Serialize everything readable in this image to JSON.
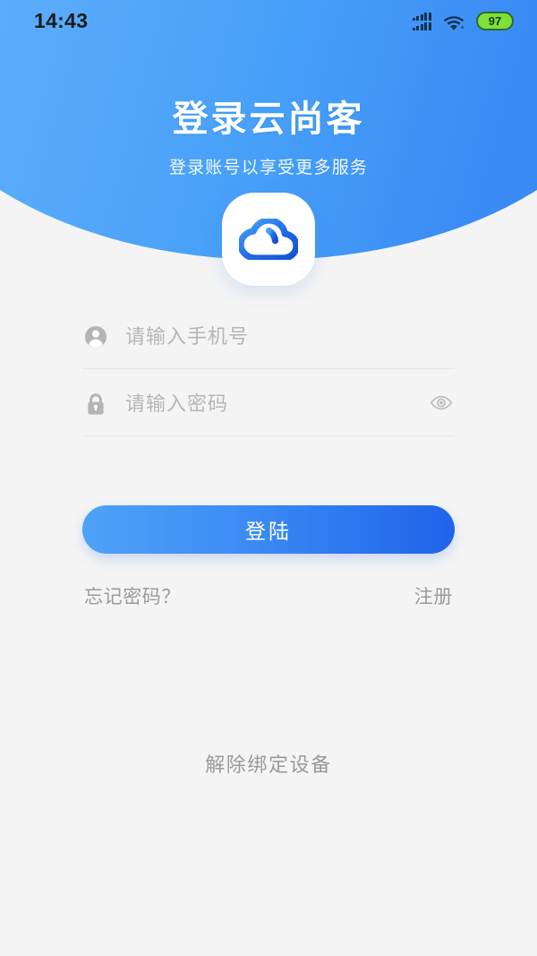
{
  "status_bar": {
    "time": "14:43",
    "signal_icon": "dual-signal-bars-icon",
    "wifi_icon": "wifi-icon",
    "battery_level": "97",
    "battery_icon": "battery-icon"
  },
  "header": {
    "title": "登录云尚客",
    "subtitle": "登录账号以享受更多服务",
    "logo_icon": "cloud-logo-icon"
  },
  "form": {
    "phone": {
      "icon": "person-icon",
      "placeholder": "请输入手机号",
      "value": ""
    },
    "password": {
      "icon": "lock-icon",
      "placeholder": "请输入密码",
      "value": "",
      "toggle_icon": "eye-icon"
    },
    "submit_label": "登陆",
    "forgot_password_label": "忘记密码？",
    "register_label": "注册"
  },
  "footer": {
    "unbind_label": "解除绑定设备"
  },
  "colors": {
    "header_gradient_start": "#63b2fa",
    "header_gradient_end": "#3484f2",
    "button_gradient_start": "#4ea2f7",
    "button_gradient_end": "#1f63ea",
    "page_background": "#f4f4f4",
    "placeholder_text": "#b6b6b6",
    "link_text": "#9a9a9a",
    "battery_green": "#7ee03b"
  }
}
